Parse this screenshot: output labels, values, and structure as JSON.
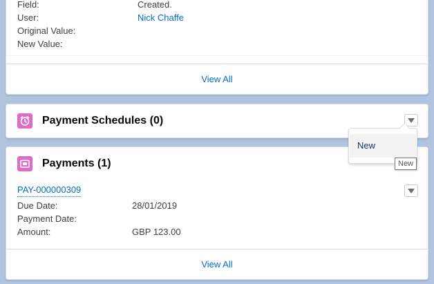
{
  "history": {
    "rows": [
      {
        "label": "Field:",
        "value": "Created."
      },
      {
        "label": "User:",
        "value": "Nick Chaffe"
      },
      {
        "label": "Original Value:",
        "value": ""
      },
      {
        "label": "New Value:",
        "value": ""
      }
    ],
    "view_all": "View All"
  },
  "payment_schedules": {
    "title": "Payment Schedules (0)",
    "icon": "calendar-clock-icon"
  },
  "dropdown_menu": {
    "items": [
      "New"
    ],
    "tooltip": "New"
  },
  "payments": {
    "title": "Payments (1)",
    "icon": "payment-icon",
    "record": {
      "name": "PAY-000000309",
      "fields": [
        {
          "label": "Due Date:",
          "value": "28/01/2019"
        },
        {
          "label": "Payment Date:",
          "value": ""
        },
        {
          "label": "Amount:",
          "value": "GBP 123.00"
        }
      ]
    },
    "view_all": "View All"
  },
  "colors": {
    "link": "#006dcc",
    "icon_bg": "#e06bc6",
    "page_bg": "#b0c4df"
  }
}
